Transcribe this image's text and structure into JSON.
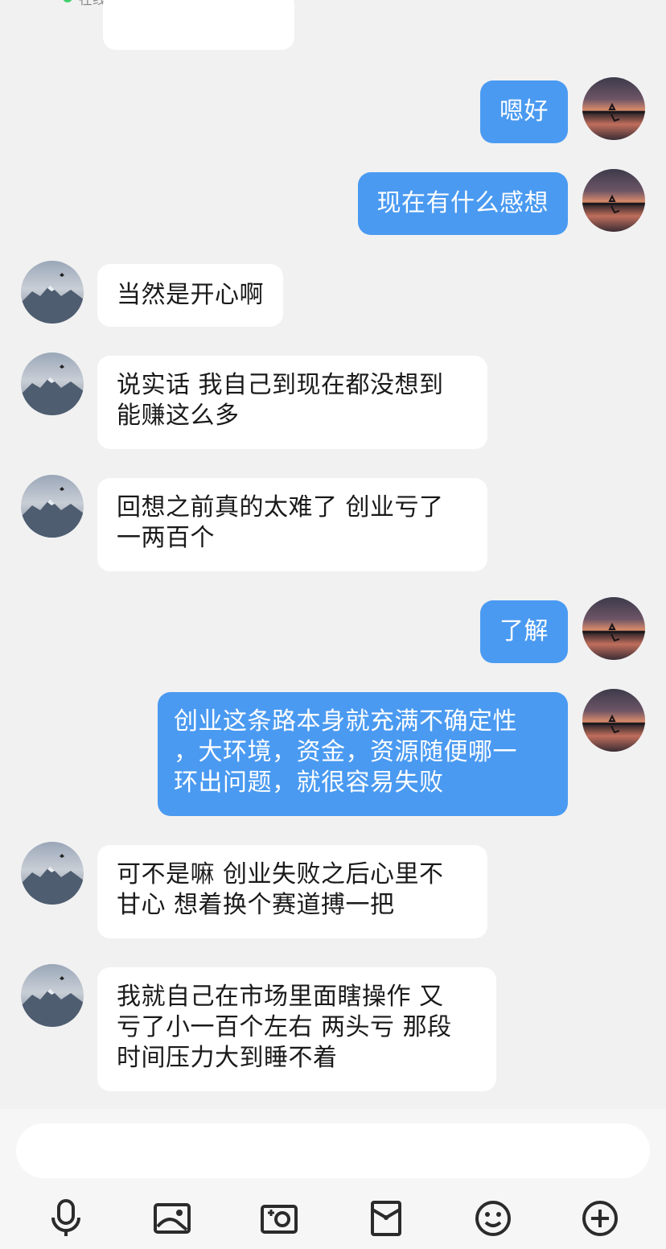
{
  "header": {
    "status_text": "在线"
  },
  "messages": [
    {
      "side": "out",
      "text": "嗯好"
    },
    {
      "side": "out",
      "text": "现在有什么感想"
    },
    {
      "side": "in",
      "text": "当然是开心啊"
    },
    {
      "side": "in",
      "text": "说实话 我自己到现在都没想到\n能赚这么多"
    },
    {
      "side": "in",
      "text": "回想之前真的太难了 创业亏了\n一两百个"
    },
    {
      "side": "out",
      "text": "了解"
    },
    {
      "side": "out",
      "text": "创业这条路本身就充满不确定性\n，大环境，资金，资源随便哪一\n环出问题，就很容易失败"
    },
    {
      "side": "in",
      "text": "可不是嘛 创业失败之后心里不\n甘心 想着换个赛道搏一把"
    },
    {
      "side": "in",
      "text": "我就自己在市场里面瞎操作 又\n亏了小一百个左右 两头亏 那段\n时间压力大到睡不着"
    }
  ],
  "input": {
    "placeholder": "",
    "value": ""
  },
  "toolbar": [
    {
      "icon": "microphone-icon"
    },
    {
      "icon": "image-icon"
    },
    {
      "icon": "camera-icon"
    },
    {
      "icon": "red-packet-icon"
    },
    {
      "icon": "emoji-icon"
    },
    {
      "icon": "plus-circle-icon"
    }
  ],
  "colors": {
    "background": "#f1f1f1",
    "outgoing_bubble": "#4a9af1",
    "incoming_bubble": "#ffffff",
    "online_dot": "#3ecf6b"
  }
}
